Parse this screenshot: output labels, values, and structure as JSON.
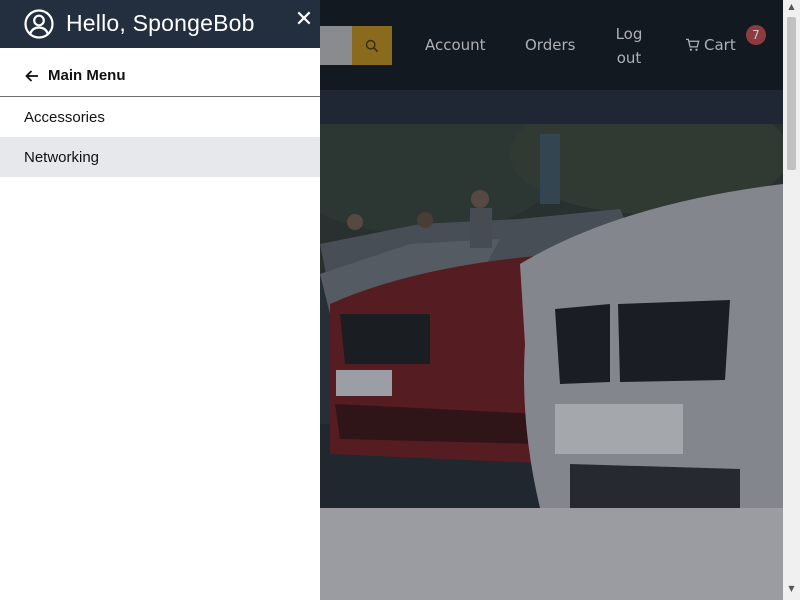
{
  "header": {
    "nav": {
      "account": "Account",
      "orders": "Orders",
      "logout": "Log out",
      "cart": "Cart",
      "cart_count": "7"
    }
  },
  "drawer": {
    "greeting": "Hello, SpongeBob",
    "back_label": "Main Menu",
    "items": [
      {
        "label": "Accessories",
        "selected": false
      },
      {
        "label": "Networking",
        "selected": true
      }
    ]
  },
  "colors": {
    "header_bg": "#232f3e",
    "topbar_bg": "#131921",
    "search_button": "#febd69",
    "cart_badge": "#e04850",
    "selected_item_bg": "#e7e8eb"
  }
}
